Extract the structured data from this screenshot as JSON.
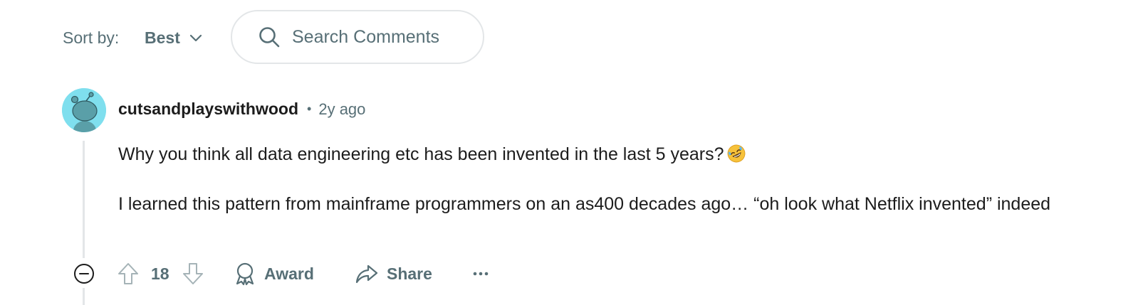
{
  "sort": {
    "label": "Sort by:",
    "selected": "Best"
  },
  "search": {
    "placeholder": "Search Comments"
  },
  "comment": {
    "author": "cutsandplayswithwood",
    "separator": "•",
    "time": "2y ago",
    "paragraphs": [
      "Why you think all data engineering etc has been invented in the last 5 years?",
      "I learned this pattern from mainframe programmers on an as400 decades ago… “oh look what Netflix invented” indeed"
    ],
    "emoji": "rolling-on-floor-laughing",
    "score": "18"
  },
  "actions": {
    "award_label": "Award",
    "share_label": "Share"
  },
  "colors": {
    "meta_text": "#576f76",
    "body_text": "#1c1c1c",
    "avatar_bg": "#7fdfee",
    "border": "#e3e6e8"
  },
  "icons": [
    "chevron-down-icon",
    "search-icon",
    "snoo-avatar-icon",
    "collapse-icon",
    "upvote-icon",
    "downvote-icon",
    "award-icon",
    "share-icon",
    "more-options-icon",
    "laughing-emoji-icon"
  ]
}
